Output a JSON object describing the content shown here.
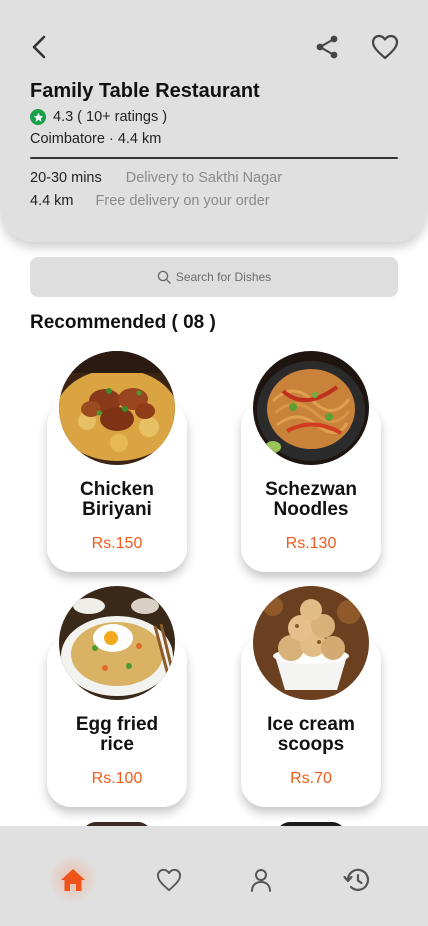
{
  "header": {
    "restaurant_name": "Family Table Restaurant",
    "rating_text": "4.3 ( 10+ ratings )",
    "location_text": "Coimbatore · 4.4 km",
    "delivery_time": "20-30 mins",
    "delivery_to": "Delivery to Sakthi Nagar",
    "distance": "4.4 km",
    "delivery_fee_note": "Free delivery on your order",
    "icons": {
      "back": "back-arrow-icon",
      "share": "share-icon",
      "favorite": "heart-icon",
      "rating": "star-icon"
    },
    "rating_color": "#17a04a"
  },
  "search": {
    "placeholder": "Search for Dishes",
    "icon": "search-icon"
  },
  "section": {
    "title": "Recommended ( 08 )"
  },
  "dishes": [
    {
      "name_line1": "Chicken",
      "name_line2": "Biriyani",
      "price": "Rs.150",
      "image": "chicken-biriyani-photo"
    },
    {
      "name_line1": "Schezwan",
      "name_line2": "Noodles",
      "price": "Rs.130",
      "image": "schezwan-noodles-photo"
    },
    {
      "name_line1": "Egg fried",
      "name_line2": "rice",
      "price": "Rs.100",
      "image": "egg-fried-rice-photo"
    },
    {
      "name_line1": "Ice cream",
      "name_line2": "scoops",
      "price": "Rs.70",
      "image": "ice-cream-scoops-photo"
    }
  ],
  "price_color": "#f05a1a",
  "bottom_nav": {
    "items": [
      {
        "icon": "home-icon",
        "active": true
      },
      {
        "icon": "heart-icon",
        "active": false
      },
      {
        "icon": "user-icon",
        "active": false
      },
      {
        "icon": "history-icon",
        "active": false
      }
    ],
    "active_color": "#f0531a"
  }
}
